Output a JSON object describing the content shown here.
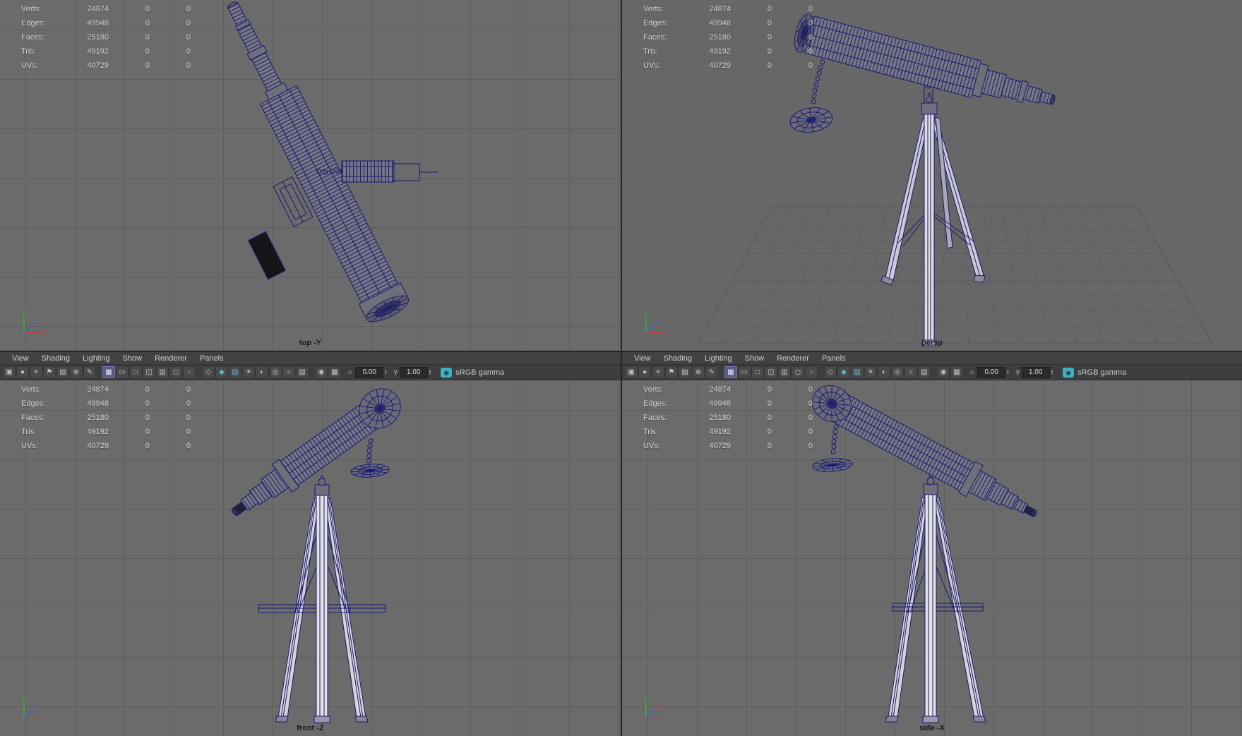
{
  "colors": {
    "wireframe": "#1a1a74",
    "accent_teal": "#3fb0c0",
    "viewport_bg": "#6b6b6b"
  },
  "hud_rows": [
    {
      "label": "Verts:",
      "v1": "24874",
      "v2": "0",
      "v3": "0"
    },
    {
      "label": "Edges:",
      "v1": "49948",
      "v2": "0",
      "v3": "0"
    },
    {
      "label": "Faces:",
      "v1": "25180",
      "v2": "0",
      "v3": "0"
    },
    {
      "label": "Tris:",
      "v1": "49192",
      "v2": "0",
      "v3": "0"
    },
    {
      "label": "UVs:",
      "v1": "40729",
      "v2": "0",
      "v3": "0"
    }
  ],
  "menu_items": [
    "View",
    "Shading",
    "Lighting",
    "Show",
    "Renderer",
    "Panels"
  ],
  "toolbar": {
    "icons": [
      {
        "name": "select-camera-icon",
        "glyph": "▣"
      },
      {
        "name": "lock-camera-icon",
        "glyph": "●"
      },
      {
        "name": "camera-attributes-icon",
        "glyph": "≡"
      },
      {
        "name": "bookmark-icon",
        "glyph": "⚑"
      },
      {
        "name": "image-plane-icon",
        "glyph": "▤"
      },
      {
        "name": "2d-pan-zoom-icon",
        "glyph": "⊕"
      },
      {
        "name": "grease-pencil-icon",
        "glyph": "✎"
      },
      {
        "name": "toolbar-separator",
        "glyph": "",
        "sep": true
      },
      {
        "name": "grid-icon",
        "glyph": "▦",
        "active": true
      },
      {
        "name": "film-gate-icon",
        "glyph": "▭"
      },
      {
        "name": "resolution-gate-icon",
        "glyph": "□"
      },
      {
        "name": "gate-mask-icon",
        "glyph": "◫"
      },
      {
        "name": "field-chart-icon",
        "glyph": "▥"
      },
      {
        "name": "safe-action-icon",
        "glyph": "◻"
      },
      {
        "name": "safe-title-icon",
        "glyph": "▫"
      },
      {
        "name": "toolbar-separator",
        "glyph": "",
        "sep": true
      },
      {
        "name": "wireframe-icon",
        "glyph": "◇"
      },
      {
        "name": "shaded-icon",
        "glyph": "◆",
        "tint": true
      },
      {
        "name": "textured-icon",
        "glyph": "▨",
        "tint": true
      },
      {
        "name": "use-all-lights-icon",
        "glyph": "☀"
      },
      {
        "name": "shadows-icon",
        "glyph": "◐"
      },
      {
        "name": "ambient-occlusion-icon",
        "glyph": "◎"
      },
      {
        "name": "motion-blur-icon",
        "glyph": "≈"
      },
      {
        "name": "anti-alias-icon",
        "glyph": "▧"
      },
      {
        "name": "toolbar-separator",
        "glyph": "",
        "sep": true
      },
      {
        "name": "isolate-select-icon",
        "glyph": "◉"
      },
      {
        "name": "x-ray-icon",
        "glyph": "▩"
      }
    ],
    "exposure_icon": "☼",
    "exposure_value": "0.00",
    "gamma_icon": "γ",
    "gamma_value": "1.00",
    "spinner_up": "▴",
    "spinner_down": "▾",
    "cm_glyph": "◉",
    "color_mgmt_label": "sRGB gamma"
  },
  "viewports": {
    "top_left": {
      "label": "top -Y"
    },
    "top_right": {
      "label": "persp"
    },
    "bottom_left": {
      "label": "front -Z"
    },
    "bottom_right": {
      "label": "side -X"
    }
  },
  "gizmo": {
    "x": "x",
    "y": "y",
    "z": "z"
  }
}
